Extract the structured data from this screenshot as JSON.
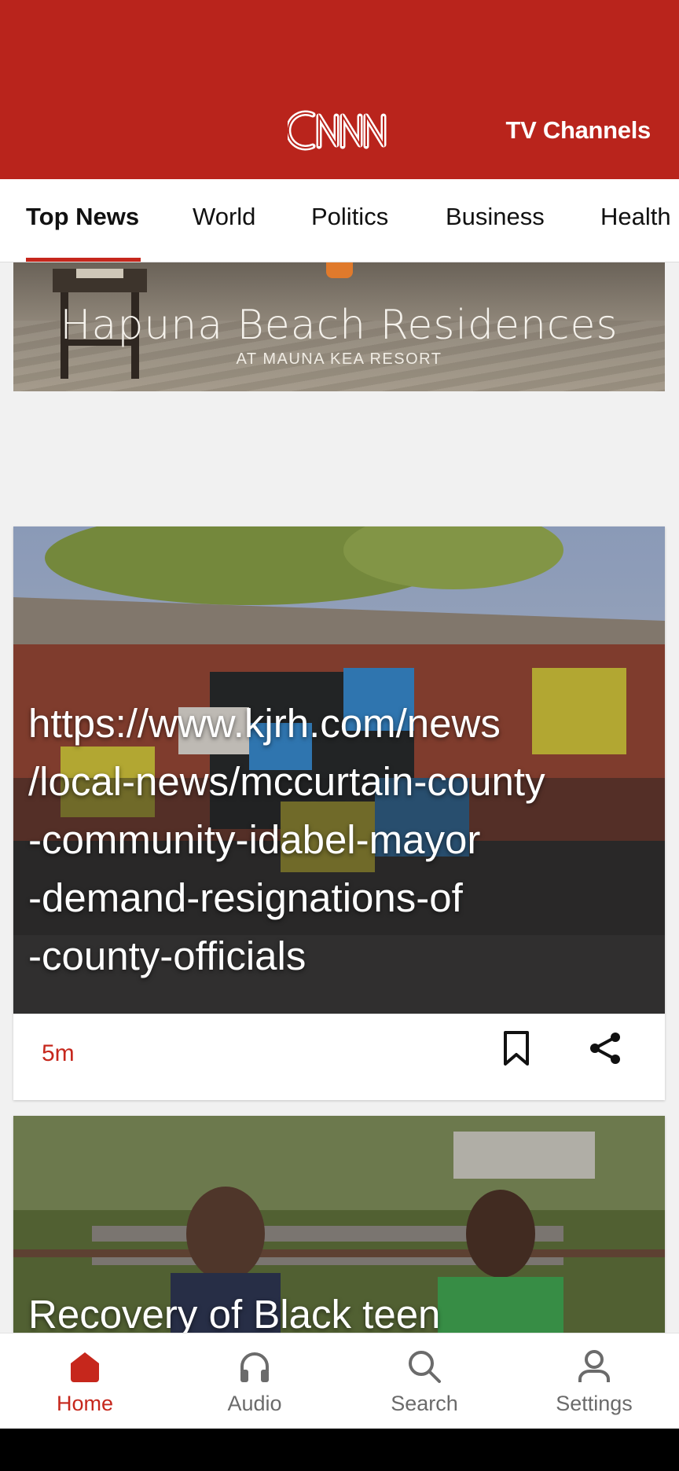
{
  "header": {
    "brand": "CNN",
    "tv_channels_label": "TV Channels",
    "color": "#b9241c"
  },
  "tabs": [
    {
      "label": "Top News",
      "active": true
    },
    {
      "label": "World",
      "active": false
    },
    {
      "label": "Politics",
      "active": false
    },
    {
      "label": "Business",
      "active": false
    },
    {
      "label": "Health",
      "active": false
    }
  ],
  "ad": {
    "title": "Hapuna Beach Residences",
    "subtitle": "AT MAUNA KEA RESORT"
  },
  "stories": [
    {
      "headline": "https://www.kjrh.com/news/local-news/mccurtain-county-community-idabel-mayor-demand-resignations-of-county-officials",
      "headline_lines": [
        "https://www.kjrh.com/news",
        "/local-news/mccurtain-county",
        "-community-idabel-mayor",
        "-demand-resignations-of",
        "-county-officials"
      ],
      "time": "5m",
      "bookmark_icon": "bookmark-icon",
      "share_icon": "share-icon"
    },
    {
      "headline": "Recovery of Black teen"
    }
  ],
  "bottom_nav": [
    {
      "label": "Home",
      "icon": "home-icon",
      "active": true
    },
    {
      "label": "Audio",
      "icon": "headphones-icon",
      "active": false
    },
    {
      "label": "Search",
      "icon": "search-icon",
      "active": false
    },
    {
      "label": "Settings",
      "icon": "person-icon",
      "active": false
    }
  ],
  "colors": {
    "accent": "#c6271c",
    "background": "#f1f1f1"
  }
}
